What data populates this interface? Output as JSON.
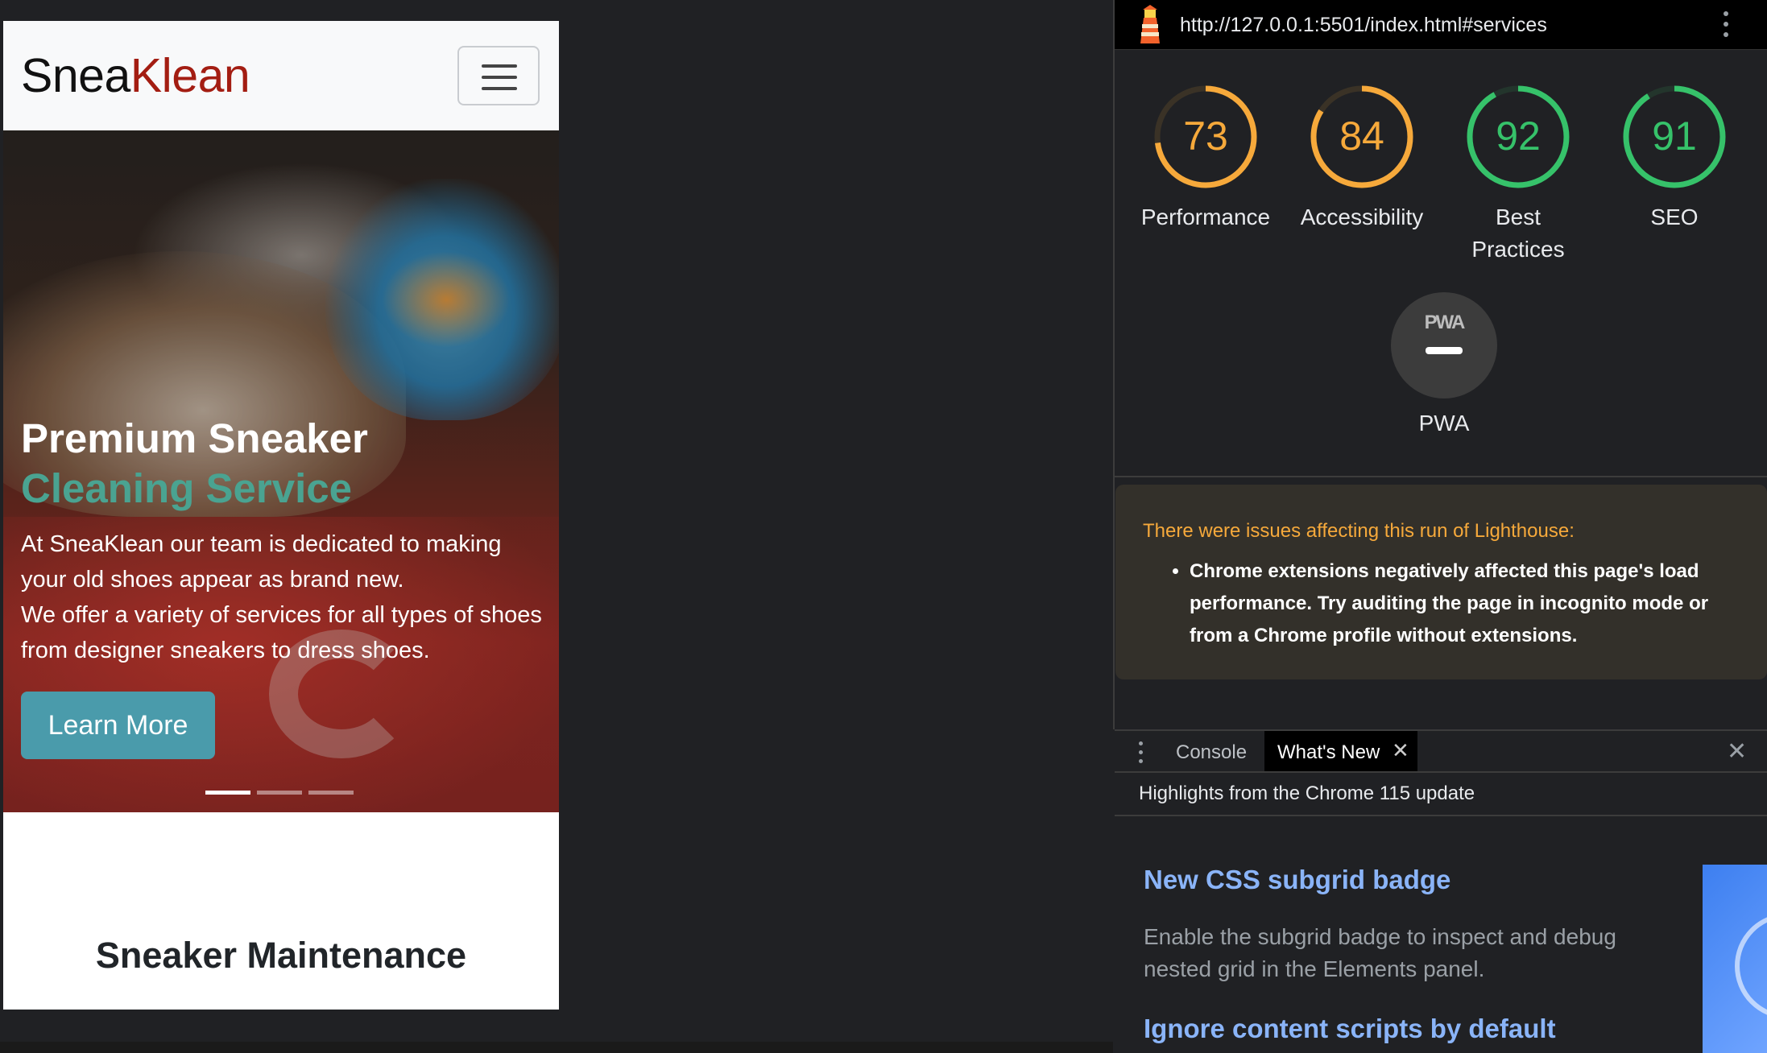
{
  "site": {
    "brand_part1": "Snea",
    "brand_part2": "Klean",
    "hero": {
      "title_main": "Premium Sneaker ",
      "title_accent": "Cleaning Service",
      "text_line1": "At SneaKlean our team is dedicated to making your old shoes appear as brand new.",
      "text_line2": "We offer a variety of services for all types of shoes from designer sneakers to dress shoes.",
      "button": "Learn More",
      "slides": 3,
      "active_slide": 1
    },
    "section_title": "Sneaker Maintenance"
  },
  "devtools": {
    "url": "http://127.0.0.1:5501/index.html#services",
    "scores": [
      {
        "value": "73",
        "label": "Performance",
        "color": "#f6a93b"
      },
      {
        "value": "84",
        "label": "Accessibility",
        "color": "#f6a93b"
      },
      {
        "value": "92",
        "label": "Best Practices",
        "color": "#36c26a"
      },
      {
        "value": "91",
        "label": "SEO",
        "color": "#36c26a"
      }
    ],
    "pwa": {
      "badge": "PWA",
      "label": "PWA"
    },
    "warning": {
      "title": "There were issues affecting this run of Lighthouse:",
      "item": "Chrome extensions negatively affected this page's load performance. Try auditing the page in incognito mode or from a Chrome profile without extensions."
    },
    "drawer": {
      "tab_console": "Console",
      "tab_whats_new": "What's New",
      "highlights": "Highlights from the Chrome 115 update",
      "item1_title": "New CSS subgrid badge",
      "item1_text": "Enable the subgrid badge to inspect and debug nested grid in the Elements panel.",
      "item2_title": "Ignore content scripts by default"
    }
  }
}
